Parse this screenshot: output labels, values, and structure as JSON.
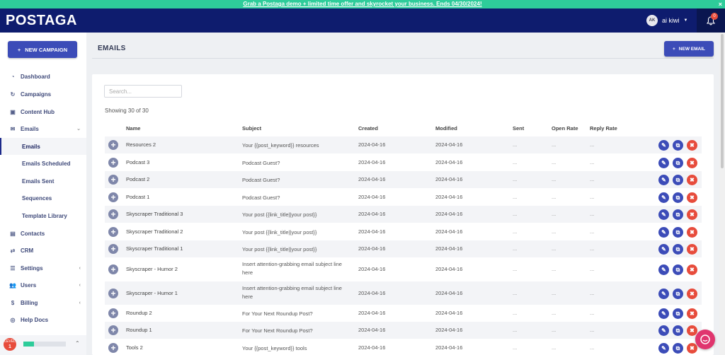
{
  "promo": {
    "text": "Grab a Postaga demo + limited time offer and skyrocket your business. Ends 04/30/2024!",
    "close": "×"
  },
  "header": {
    "logo": "POSTAGA",
    "user_initials": "AK",
    "user_name": "ai kiwi",
    "notification_count": "0"
  },
  "sidebar": {
    "new_campaign": "NEW CAMPAIGN",
    "items": [
      {
        "label": "Dashboard",
        "icon": "dashboard-icon"
      },
      {
        "label": "Campaigns",
        "icon": "campaigns-icon"
      },
      {
        "label": "Content Hub",
        "icon": "content-hub-icon"
      },
      {
        "label": "Emails",
        "icon": "envelope-icon"
      },
      {
        "label": "Emails"
      },
      {
        "label": "Emails Scheduled"
      },
      {
        "label": "Emails Sent"
      },
      {
        "label": "Sequences"
      },
      {
        "label": "Template Library"
      },
      {
        "label": "Contacts",
        "icon": "contacts-icon"
      },
      {
        "label": "CRM",
        "icon": "crm-icon"
      },
      {
        "label": "Settings",
        "icon": "settings-icon"
      },
      {
        "label": "Users",
        "icon": "users-icon"
      },
      {
        "label": "Billing",
        "icon": "dollar-icon"
      },
      {
        "label": "Help Docs",
        "icon": "help-icon"
      }
    ],
    "level_label": "LEVEL",
    "level_value": "1",
    "level_progress": 0.25
  },
  "main": {
    "title": "EMAILS",
    "new_email": "NEW EMAIL",
    "search_placeholder": "Search...",
    "showing": "Showing 30 of 30",
    "columns": [
      "Name",
      "Subject",
      "Created",
      "Modified",
      "Sent",
      "Open Rate",
      "Reply Rate"
    ],
    "rows": [
      {
        "name": "Resources 2",
        "subject": "Your {{post_keyword}} resources",
        "created": "2024-04-16",
        "modified": "2024-04-16",
        "sent": "...",
        "open": "...",
        "reply": "..."
      },
      {
        "name": "Podcast 3",
        "subject": "Podcast Guest?",
        "created": "2024-04-16",
        "modified": "2024-04-16",
        "sent": "...",
        "open": "...",
        "reply": "..."
      },
      {
        "name": "Podcast 2",
        "subject": "Podcast Guest?",
        "created": "2024-04-16",
        "modified": "2024-04-16",
        "sent": "...",
        "open": "...",
        "reply": "..."
      },
      {
        "name": "Podcast 1",
        "subject": "Podcast Guest?",
        "created": "2024-04-16",
        "modified": "2024-04-16",
        "sent": "...",
        "open": "...",
        "reply": "..."
      },
      {
        "name": "Skyscraper Traditional 3",
        "subject": "Your post {{link_title||your post}}",
        "created": "2024-04-16",
        "modified": "2024-04-16",
        "sent": "...",
        "open": "...",
        "reply": "..."
      },
      {
        "name": "Skyscraper Traditional 2",
        "subject": "Your post {{link_title||your post}}",
        "created": "2024-04-16",
        "modified": "2024-04-16",
        "sent": "...",
        "open": "...",
        "reply": "..."
      },
      {
        "name": "Skyscraper Traditional 1",
        "subject": "Your post {{link_title||your post}}",
        "created": "2024-04-16",
        "modified": "2024-04-16",
        "sent": "...",
        "open": "...",
        "reply": "..."
      },
      {
        "name": "Skyscraper - Humor 2",
        "subject": "Insert attention-grabbing email subject line here",
        "created": "2024-04-16",
        "modified": "2024-04-16",
        "sent": "...",
        "open": "...",
        "reply": "..."
      },
      {
        "name": "Skyscraper - Humor 1",
        "subject": "Insert attention-grabbing email subject line here",
        "created": "2024-04-16",
        "modified": "2024-04-16",
        "sent": "...",
        "open": "...",
        "reply": "..."
      },
      {
        "name": "Roundup 2",
        "subject": "For Your Next Roundup Post?",
        "created": "2024-04-16",
        "modified": "2024-04-16",
        "sent": "...",
        "open": "...",
        "reply": "..."
      },
      {
        "name": "Roundup 1",
        "subject": "For Your Next Roundup Post?",
        "created": "2024-04-16",
        "modified": "2024-04-16",
        "sent": "...",
        "open": "...",
        "reply": "..."
      },
      {
        "name": "Tools 2",
        "subject": "Your {{post_keyword}} tools",
        "created": "2024-04-16",
        "modified": "2024-04-16",
        "sent": "...",
        "open": "...",
        "reply": "..."
      }
    ]
  },
  "colors": {
    "brand_navy": "#0e1c6e",
    "primary": "#3c4cb8",
    "danger": "#e74c3c",
    "promo": "#2ecc9a"
  }
}
